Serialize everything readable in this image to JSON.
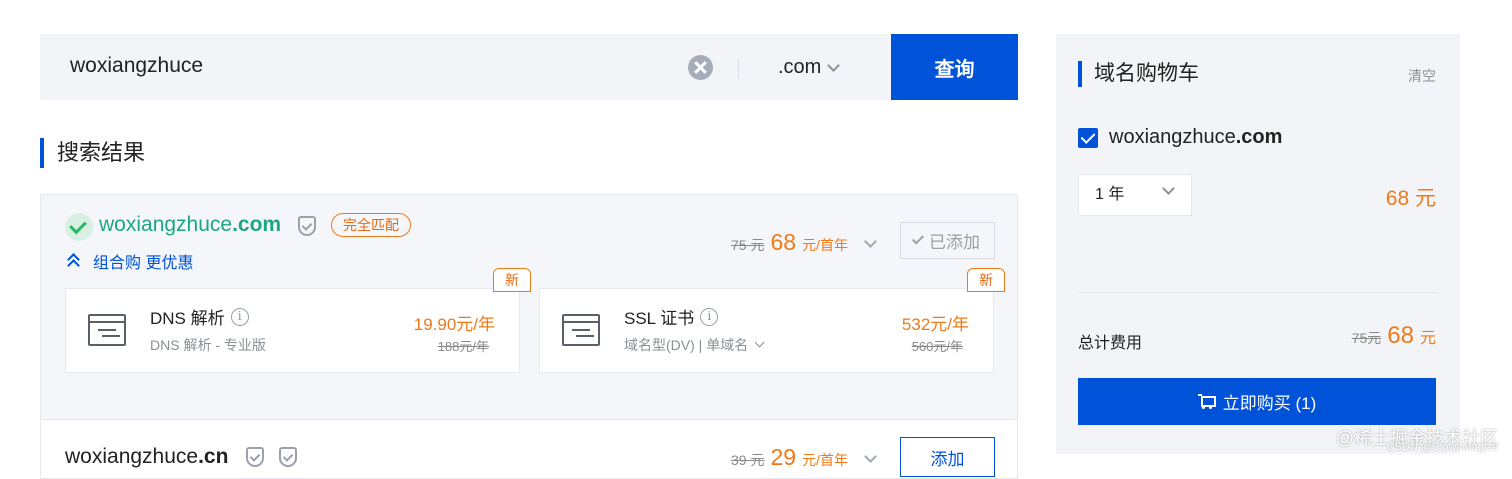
{
  "search": {
    "value": "woxiangzhuce",
    "tld": ".com",
    "query_label": "查询"
  },
  "results": {
    "title": "搜索结果",
    "primary": {
      "name": "woxiangzhuce",
      "tld": ".com",
      "badge": "完全匹配",
      "combo_label": "组合购 更优惠",
      "old_price": "75 元",
      "price": "68",
      "unit": "元/首年",
      "action": "已添加"
    },
    "addons": [
      {
        "tag": "新",
        "name": "DNS 解析",
        "desc": "DNS 解析 - 专业版",
        "price": "19.90元/年",
        "old_price": "188元/年"
      },
      {
        "tag": "新",
        "name": "SSL 证书",
        "desc": "域名型(DV) | 单域名",
        "price": "532元/年",
        "old_price": "560元/年"
      }
    ],
    "secondary": {
      "name": "woxiangzhuce",
      "tld": ".cn",
      "old_price": "39 元",
      "price": "29",
      "unit": "元/首年",
      "action": "添加"
    }
  },
  "cart": {
    "title": "域名购物车",
    "clear_label": "清空",
    "item_name": "woxiangzhuce",
    "item_tld": ".com",
    "year": "1 年",
    "item_price": "68 元",
    "total_label": "总计费用",
    "total_old": "75元",
    "total_price": "68",
    "total_unit": "元",
    "buy_label": "立即购买 (1)"
  },
  "watermark": {
    "main": "@稀土掘金技术社区",
    "sub": "CSDN @ClownMagize"
  },
  "colors": {
    "brand_blue": "#0052d9",
    "price_orange": "#f07a18",
    "success_green": "#1ba784"
  }
}
